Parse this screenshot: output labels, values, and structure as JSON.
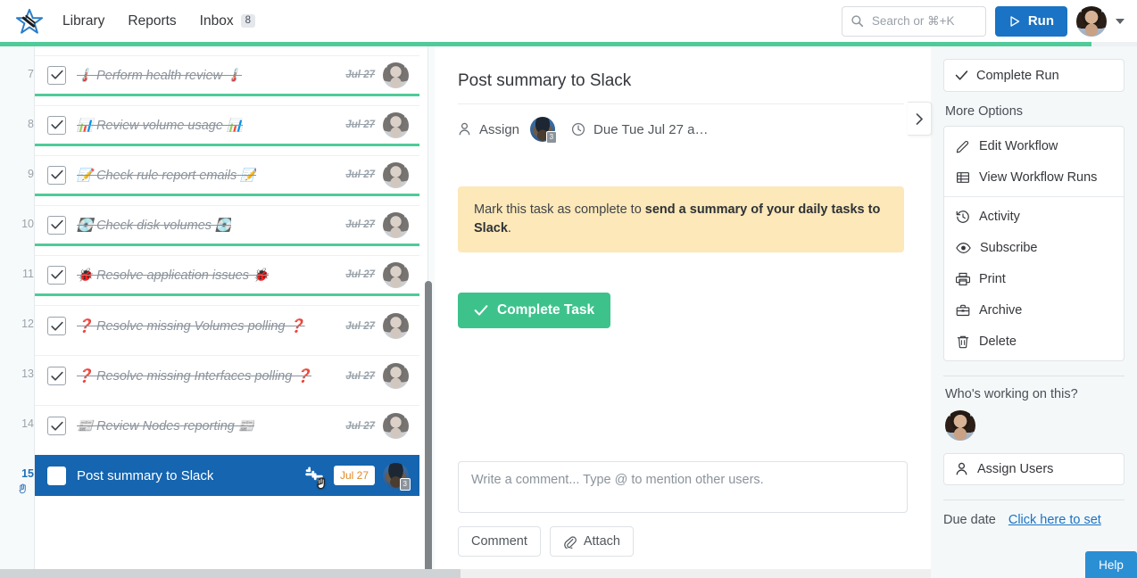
{
  "header": {
    "logo_icon": "star-logo-icon",
    "nav": [
      {
        "label": "Library",
        "name": "nav-library"
      },
      {
        "label": "Reports",
        "name": "nav-reports"
      },
      {
        "label": "Inbox",
        "name": "nav-inbox",
        "badge": "8"
      }
    ],
    "search": {
      "placeholder": "Search or ⌘+K",
      "value": "",
      "icon": "search-icon"
    },
    "run_button": {
      "label": "Run",
      "icon": "play-icon"
    },
    "account_chevron": "chevron-down-icon"
  },
  "progress": {
    "percent": 96
  },
  "task_list": {
    "scroll_thumb": true,
    "rows": [
      {
        "num": "7",
        "title": "🌡️ Perform health review 🌡️",
        "date": "Jul 27",
        "checked": true,
        "selected": false,
        "separator": true
      },
      {
        "num": "8",
        "title": "📊 Review volume usage 📊",
        "date": "Jul 27",
        "checked": true,
        "selected": false,
        "separator": true
      },
      {
        "num": "9",
        "title": "📝 Check rule report emails 📝",
        "date": "Jul 27",
        "checked": true,
        "selected": false,
        "separator": true
      },
      {
        "num": "10",
        "title": "💽 Check disk volumes 💽",
        "date": "Jul 27",
        "checked": true,
        "selected": false,
        "separator": true
      },
      {
        "num": "11",
        "title": "🐞 Resolve application issues 🐞",
        "date": "Jul 27",
        "checked": true,
        "selected": false,
        "separator": true
      },
      {
        "num": "12",
        "title": "❓ Resolve missing Volumes polling ❓",
        "date": "Jul 27",
        "checked": true,
        "selected": false,
        "separator": false
      },
      {
        "num": "13",
        "title": "❓ Resolve missing Interfaces polling ❓",
        "date": "Jul 27",
        "checked": true,
        "selected": false,
        "separator": false
      },
      {
        "num": "14",
        "title": "📰 Review Nodes reporting 📰",
        "date": "Jul 27",
        "checked": true,
        "selected": false,
        "separator": false
      },
      {
        "num": "15",
        "title": "Post summary to Slack",
        "date": "Jul 27",
        "checked": false,
        "selected": true,
        "separator": false
      }
    ],
    "selected_row_icons": {
      "integration": "slack-icon",
      "cursor": "hand-cursor-icon",
      "avatar_count": "3"
    }
  },
  "detail": {
    "title": "Post summary to Slack",
    "assign": {
      "label": "Assign",
      "icon": "person-icon",
      "avatar_count": "3"
    },
    "due": {
      "label": "Due Tue Jul 27 a…",
      "icon": "clock-icon"
    },
    "alert": {
      "prefix": "Mark this task as complete to ",
      "strong": "send a summary of your daily tasks to Slack",
      "suffix": "."
    },
    "complete_task_button": {
      "label": "Complete Task",
      "icon": "check-icon"
    },
    "comment": {
      "placeholder": "Write a comment... Type @ to mention other users.",
      "value": "",
      "comment_button": "Comment",
      "attach_button": "Attach",
      "attach_icon": "paperclip-icon"
    },
    "collapse_tab_icon": "chevron-right-icon"
  },
  "sidebar": {
    "complete_run": {
      "label": "Complete Run",
      "icon": "check-icon"
    },
    "more_options_label": "More Options",
    "menu": [
      {
        "label": "Edit Workflow",
        "icon": "pencil-icon",
        "divider_after": false
      },
      {
        "label": "View Workflow Runs",
        "icon": "table-icon",
        "divider_after": true
      },
      {
        "label": "Activity",
        "icon": "history-icon",
        "divider_after": false
      },
      {
        "label": "Subscribe",
        "icon": "eye-icon",
        "divider_after": false
      },
      {
        "label": "Print",
        "icon": "printer-icon",
        "divider_after": false
      },
      {
        "label": "Archive",
        "icon": "archive-icon",
        "divider_after": false
      },
      {
        "label": "Delete",
        "icon": "trash-icon",
        "divider_after": false
      }
    ],
    "who_label": "Who's working on this?",
    "assign_users": {
      "label": "Assign Users",
      "icon": "person-icon"
    },
    "due_date": {
      "label": "Due date",
      "link": "Click here to set"
    }
  },
  "help": {
    "label": "Help"
  },
  "colors": {
    "accent_blue": "#1a73c4",
    "selected_row": "#1565b0",
    "green": "#4ecb98",
    "complete_green": "#3ec28c",
    "alert_yellow": "#fce8b8",
    "date_orange": "#e08a28",
    "help_blue": "#2b8fd4"
  }
}
